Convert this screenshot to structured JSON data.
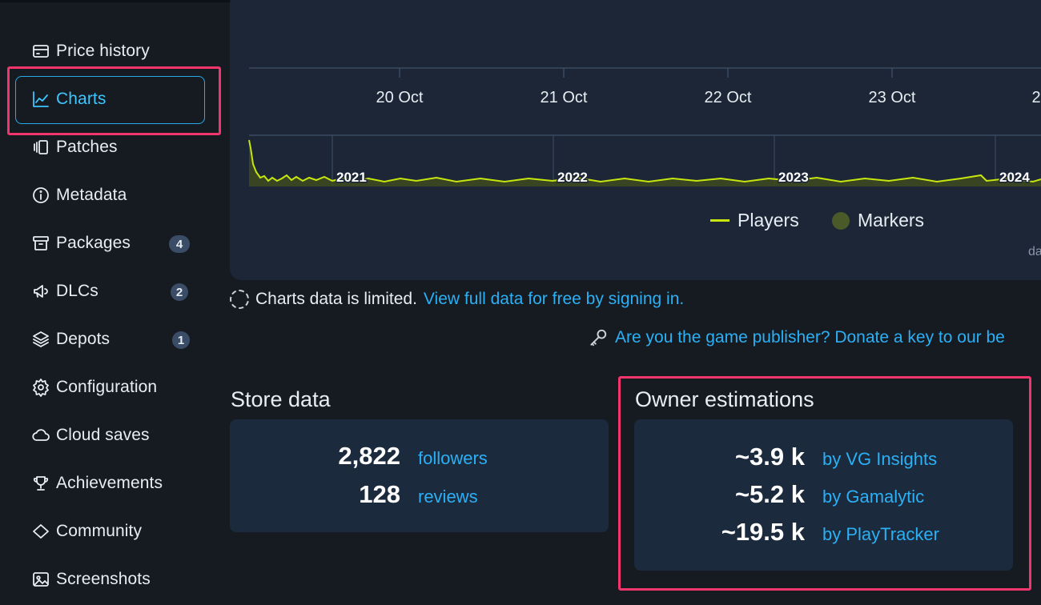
{
  "sidebar": {
    "items": [
      {
        "label": "Price history",
        "icon": "price-tag-icon"
      },
      {
        "label": "Charts",
        "icon": "chart-icon",
        "active": true
      },
      {
        "label": "Patches",
        "icon": "patches-icon"
      },
      {
        "label": "Metadata",
        "icon": "info-icon"
      },
      {
        "label": "Packages",
        "icon": "package-icon",
        "badge": "4"
      },
      {
        "label": "DLCs",
        "icon": "dlc-icon",
        "badge": "2"
      },
      {
        "label": "Depots",
        "icon": "layers-icon",
        "badge": "1"
      },
      {
        "label": "Configuration",
        "icon": "gear-icon"
      },
      {
        "label": "Cloud saves",
        "icon": "cloud-icon"
      },
      {
        "label": "Achievements",
        "icon": "trophy-icon"
      },
      {
        "label": "Community",
        "icon": "diamond-icon"
      },
      {
        "label": "Screenshots",
        "icon": "image-icon"
      }
    ]
  },
  "chart": {
    "date_ticks": [
      "20 Oct",
      "21 Oct",
      "22 Oct",
      "23 Oct",
      "2"
    ],
    "year_ticks": [
      "2021",
      "2022",
      "2023",
      "2024"
    ],
    "legend": {
      "players": "Players",
      "markers": "Markers"
    },
    "cut_text": "da",
    "colors": {
      "players": "#c7e60e",
      "markers": "#4a5a28"
    }
  },
  "chart_data": {
    "type": "line",
    "series": [
      {
        "name": "Players"
      }
    ],
    "x_ticks_top": [
      "20 Oct",
      "21 Oct",
      "22 Oct",
      "23 Oct"
    ],
    "x_ticks_navigator": [
      "2021",
      "2022",
      "2023",
      "2024"
    ],
    "legend": [
      "Players",
      "Markers"
    ]
  },
  "notice": {
    "text": "Charts data is limited.",
    "link": "View full data for free by signing in."
  },
  "publisher": {
    "link": "Are you the game publisher? Donate a key to our be"
  },
  "store_data": {
    "title": "Store data",
    "rows": [
      {
        "value": "2,822",
        "label": "followers"
      },
      {
        "value": "128",
        "label": "reviews"
      }
    ]
  },
  "owner_estimations": {
    "title": "Owner estimations",
    "rows": [
      {
        "value": "~3.9 k",
        "label": "by VG Insights"
      },
      {
        "value": "~5.2 k",
        "label": "by Gamalytic"
      },
      {
        "value": "~19.5 k",
        "label": "by PlayTracker"
      }
    ]
  }
}
